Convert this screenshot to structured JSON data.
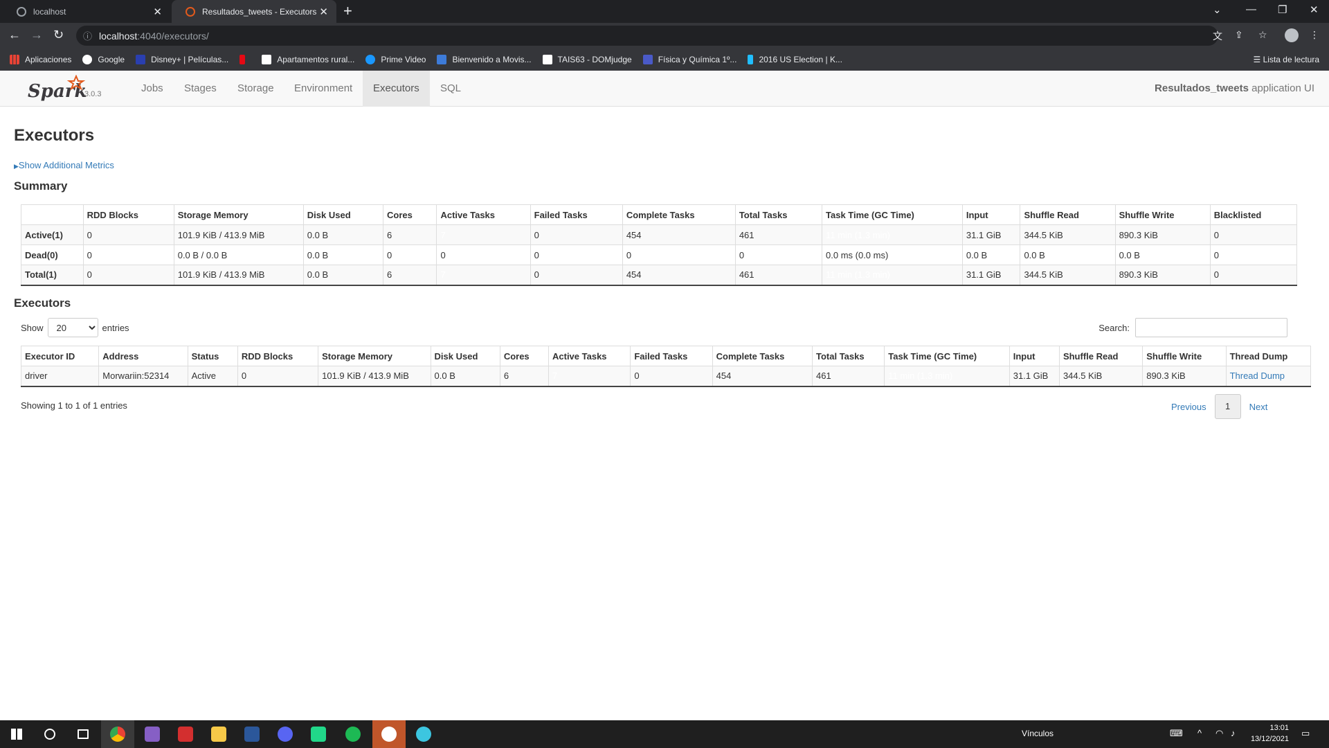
{
  "browser": {
    "tabs": [
      {
        "title": "localhost"
      },
      {
        "title": "Resultados_tweets - Executors"
      }
    ],
    "url_host": "localhost",
    "url_path": ":4040/executors/",
    "bookmarks": [
      {
        "label": "Aplicaciones",
        "color": "#e8eaed"
      },
      {
        "label": "Google",
        "color": "#ffffff"
      },
      {
        "label": "Disney+ | Películas...",
        "color": "#2a3fb0"
      },
      {
        "label": "",
        "color": "#e50914"
      },
      {
        "label": "Apartamentos rural...",
        "color": "#ffffff"
      },
      {
        "label": "Prime Video",
        "color": "#1a98ff"
      },
      {
        "label": "Bienvenido a Movis...",
        "color": "#3d7bd9"
      },
      {
        "label": "TAIS63 - DOMjudge",
        "color": "#ffffff"
      },
      {
        "label": "Física y Química 1º...",
        "color": "#4a5ac8"
      },
      {
        "label": "2016 US Election | K...",
        "color": "#20beff"
      }
    ],
    "reading_list": "Lista de lectura"
  },
  "spark": {
    "version": "3.0.3",
    "nav": [
      "Jobs",
      "Stages",
      "Storage",
      "Environment",
      "Executors",
      "SQL"
    ],
    "active_nav": "Executors",
    "app_name": "Resultados_tweets",
    "app_suffix": " application UI"
  },
  "page": {
    "title": "Executors",
    "show_metrics": "Show Additional Metrics",
    "summary_heading": "Summary",
    "executors_heading": "Executors"
  },
  "summary": {
    "columns": [
      "",
      "RDD Blocks",
      "Storage Memory",
      "Disk Used",
      "Cores",
      "Active Tasks",
      "Failed Tasks",
      "Complete Tasks",
      "Total Tasks",
      "Task Time (GC Time)",
      "Input",
      "Shuffle Read",
      "Shuffle Write",
      "Blacklisted"
    ],
    "rows": [
      [
        "Active(1)",
        "0",
        "101.9 KiB / 413.9 MiB",
        "0.0 B",
        "6",
        "7",
        "0",
        "454",
        "461",
        "11 min (1.3 min)",
        "31.1 GiB",
        "344.5 KiB",
        "890.3 KiB",
        "0"
      ],
      [
        "Dead(0)",
        "0",
        "0.0 B / 0.0 B",
        "0.0 B",
        "0",
        "0",
        "0",
        "0",
        "0",
        "0.0 ms (0.0 ms)",
        "0.0 B",
        "0.0 B",
        "0.0 B",
        "0"
      ],
      [
        "Total(1)",
        "0",
        "101.9 KiB / 413.9 MiB",
        "0.0 B",
        "6",
        "7",
        "0",
        "454",
        "461",
        "11 min (1.3 min)",
        "31.1 GiB",
        "344.5 KiB",
        "890.3 KiB",
        "0"
      ]
    ]
  },
  "executors_table": {
    "show_label": "Show",
    "entries_label": "entries",
    "page_length": "20",
    "search_label": "Search:",
    "columns": [
      "Executor ID",
      "Address",
      "Status",
      "RDD Blocks",
      "Storage Memory",
      "Disk Used",
      "Cores",
      "Active Tasks",
      "Failed Tasks",
      "Complete Tasks",
      "Total Tasks",
      "Task Time (GC Time)",
      "Input",
      "Shuffle Read",
      "Shuffle Write",
      "Thread Dump"
    ],
    "rows": [
      [
        "driver",
        "Morwariin:52314",
        "Active",
        "0",
        "101.9 KiB / 413.9 MiB",
        "0.0 B",
        "6",
        "7",
        "0",
        "454",
        "461",
        "11 min (1.3 min)",
        "31.1 GiB",
        "344.5 KiB",
        "890.3 KiB",
        "Thread Dump"
      ]
    ],
    "info": "Showing 1 to 1 of 1 entries",
    "previous": "Previous",
    "current_page": "1",
    "next": "Next"
  },
  "taskbar": {
    "links_label": "Vínculos",
    "time": "13:01",
    "date": "13/12/2021"
  },
  "colors": {
    "active_tasks": "#0000ff",
    "task_time": "#ff6666",
    "link": "#337ab7"
  }
}
